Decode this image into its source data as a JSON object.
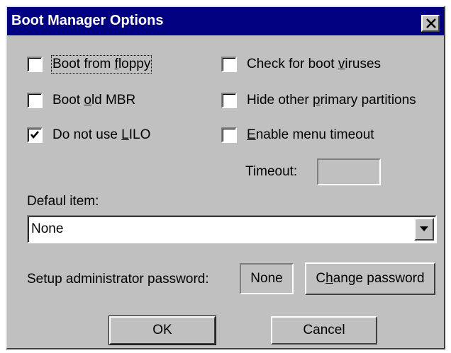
{
  "dialog": {
    "title": "Boot Manager Options",
    "close_icon": "close-x-icon"
  },
  "options": {
    "boot_floppy": {
      "before": "Boot from ",
      "key": "f",
      "after": "loppy",
      "checked": false
    },
    "boot_old_mbr": {
      "before": "Boot ",
      "key": "o",
      "after": "ld MBR",
      "checked": false
    },
    "no_lilo": {
      "before": "Do not use ",
      "key": "L",
      "after": "ILO",
      "checked": true
    },
    "check_viruses": {
      "before": "Check for boot ",
      "key": "v",
      "after": "iruses",
      "checked": false
    },
    "hide_partitions": {
      "before": "Hide other ",
      "key": "p",
      "after": "rimary partitions",
      "checked": false
    },
    "menu_timeout": {
      "before": "",
      "key": "E",
      "after": "nable menu timeout",
      "checked": false
    }
  },
  "timeout": {
    "label": "Timeout:",
    "value": ""
  },
  "default_item": {
    "label": "Defaul item:",
    "selected": "None"
  },
  "password": {
    "label": "Setup administrator password:",
    "value": "None",
    "change_before": "C",
    "change_key": "h",
    "change_after": "ange password"
  },
  "buttons": {
    "ok": "OK",
    "cancel": "Cancel"
  }
}
